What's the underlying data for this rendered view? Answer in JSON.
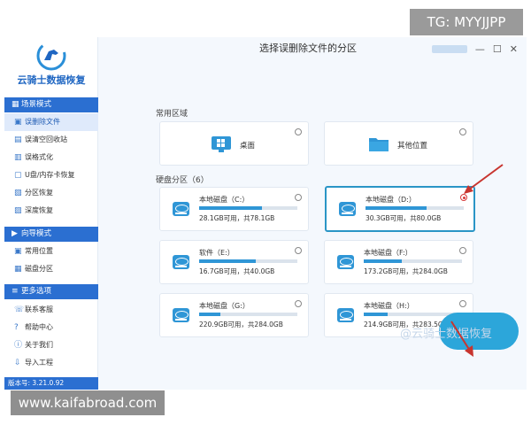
{
  "overlays": {
    "tg_badge": "TG: MYYJJPP",
    "site_badge": "www.kaifabroad.com"
  },
  "app": {
    "name": "云骑士数据恢复",
    "version": "版本号: 3.21.0.92",
    "window_controls": [
      "—",
      "☐",
      "✕"
    ]
  },
  "sidebar": {
    "sections": [
      {
        "title": "场景模式",
        "items": [
          "误删除文件",
          "误清空回收站",
          "误格式化",
          "U盘/内存卡恢复",
          "分区恢复",
          "深度恢复"
        ]
      },
      {
        "title": "向导模式",
        "items": [
          "常用位置",
          "磁盘分区"
        ]
      },
      {
        "title": "更多选项",
        "items": [
          "联系客服",
          "帮助中心",
          "关于我们",
          "导入工程"
        ]
      }
    ],
    "active_item": "误删除文件"
  },
  "main": {
    "title": "选择误删除文件的分区",
    "common_area_label": "常用区域",
    "locations": [
      {
        "label": "桌面",
        "icon": "windows-desktop-icon"
      },
      {
        "label": "其他位置",
        "icon": "folder-icon"
      }
    ],
    "disk_section_label": "硬盘分区（6）",
    "disks": [
      {
        "name": "本地磁盘（C:）",
        "free": "28.1GB可用，共78.1GB",
        "used_fraction": 0.64,
        "selected": false
      },
      {
        "name": "本地磁盘（D:）",
        "free": "30.3GB可用，共80.0GB",
        "used_fraction": 0.62,
        "selected": true
      },
      {
        "name": "软件（E:）",
        "free": "16.7GB可用，共40.0GB",
        "used_fraction": 0.58,
        "selected": false
      },
      {
        "name": "本地磁盘（F:）",
        "free": "173.2GB可用，共284.0GB",
        "used_fraction": 0.39,
        "selected": false
      },
      {
        "name": "本地磁盘（G:）",
        "free": "220.9GB可用，共284.0GB",
        "used_fraction": 0.22,
        "selected": false
      },
      {
        "name": "本地磁盘（H:）",
        "free": "214.9GB可用，共283.5GB",
        "used_fraction": 0.24,
        "selected": false
      }
    ]
  },
  "watermark": "@云骑士数据恢复",
  "colors": {
    "accent": "#2b6fd1",
    "disk_blue": "#2f96d6",
    "arrow_red": "#c8352f"
  }
}
